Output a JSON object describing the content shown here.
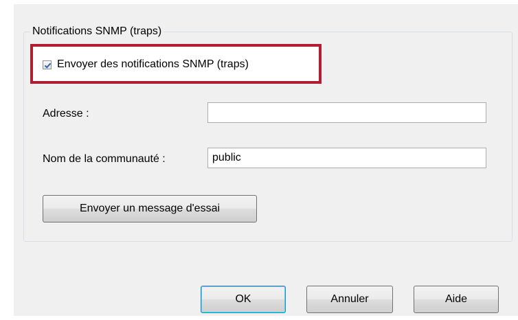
{
  "group": {
    "title": "Notifications SNMP (traps)"
  },
  "snmp_checkbox": {
    "label": "Envoyer des notifications SNMP (traps)",
    "checked": true
  },
  "address": {
    "label": "Adresse :",
    "value": ""
  },
  "community": {
    "label": "Nom de la communauté :",
    "value": "public"
  },
  "test_button": {
    "label": "Envoyer un message d'essai"
  },
  "footer": {
    "ok_label": "OK",
    "cancel_label": "Annuler",
    "help_label": "Aide"
  },
  "colors": {
    "highlight_border": "#b01e34",
    "dialog_background": "#f0f0f0",
    "checkmark": "#3a5fa0"
  }
}
